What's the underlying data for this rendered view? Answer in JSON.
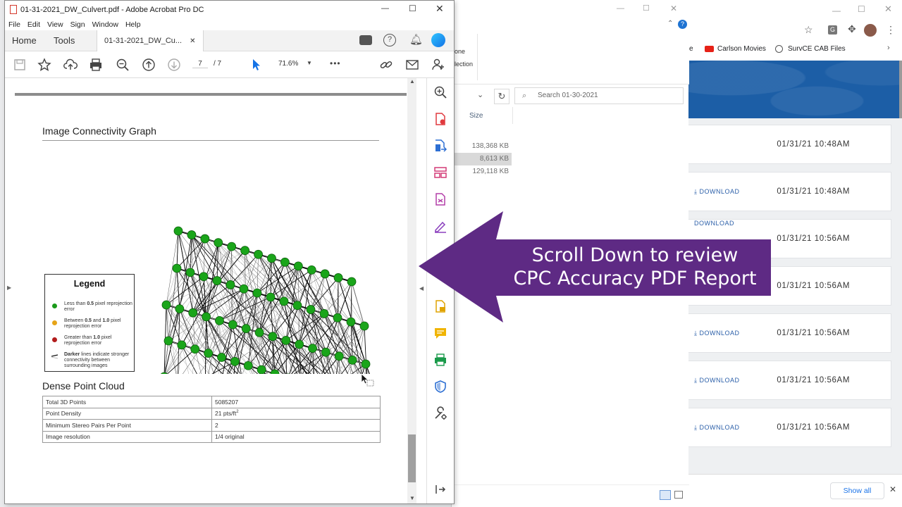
{
  "acrobat": {
    "title": "01-31-2021_DW_Culvert.pdf - Adobe Acrobat Pro DC",
    "menu": [
      "File",
      "Edit",
      "View",
      "Sign",
      "Window",
      "Help"
    ],
    "tabs": {
      "home": "Home",
      "tools": "Tools",
      "doc": "01-31-2021_DW_Cu..."
    },
    "page_current": "7",
    "page_total": "/ 7",
    "zoom": "71.6%",
    "more": "•••"
  },
  "document": {
    "section1_title": "Image Connectivity Graph",
    "legend": {
      "title": "Legend",
      "items": [
        {
          "text_parts": [
            "Less than ",
            "0.5",
            " pixel reprojection error"
          ],
          "color": "#1a9a1a"
        },
        {
          "text_parts": [
            "Between ",
            "0.5",
            " and ",
            "1.0",
            " pixel reprojection error"
          ],
          "color": "#e6a417"
        },
        {
          "text_parts": [
            "Greater than ",
            "1.0",
            " pixel reprojection error"
          ],
          "color": "#b21c1c"
        },
        {
          "text_parts": [
            "Darker",
            " lines indicate stronger connectivity between surrounding images"
          ],
          "color": "#555555"
        }
      ]
    },
    "section2_title": "Dense Point Cloud",
    "table": [
      {
        "label": "Total 3D Points",
        "value": "5085207"
      },
      {
        "label": "Point Density",
        "value": "21 pts/ft",
        "sup": "2"
      },
      {
        "label": "Minimum Stereo Pairs Per Point",
        "value": "2"
      },
      {
        "label": "Image resolution",
        "value": "1/4 original"
      }
    ]
  },
  "explorer": {
    "search_placeholder": "Search 01-30-2021",
    "column_size": "Size",
    "ribbon_text1": "one",
    "ribbon_text2": "lection",
    "sizes": [
      "138,368 KB",
      "8,613 KB",
      "129,118 KB"
    ]
  },
  "browser": {
    "bookmarks": [
      "e",
      "Carlson Movies",
      "SurvCE CAB Files"
    ],
    "downloads": [
      {
        "link": "",
        "date": "01/31/21 10:48AM"
      },
      {
        "link": "DOWNLOAD",
        "date": "01/31/21 10:48AM"
      },
      {
        "link": "DOWNLOAD",
        "date": "01/31/21 10:56AM"
      },
      {
        "link": "",
        "date": "01/31/21 10:56AM"
      },
      {
        "link": "DOWNLOAD",
        "date": "01/31/21 10:56AM"
      },
      {
        "link": "DOWNLOAD",
        "date": "01/31/21 10:56AM"
      },
      {
        "link": "DOWNLOAD",
        "date": "01/31/21 10:56AM"
      }
    ],
    "show_all": "Show all"
  },
  "annotation": {
    "line1": "Scroll Down to review",
    "line2": "CPC Accuracy PDF Report",
    "color": "#5e2a84"
  },
  "colors": {
    "node": "#1aa51a",
    "acrobat_red": "#d4392c",
    "blue_accent": "#1473e6"
  }
}
